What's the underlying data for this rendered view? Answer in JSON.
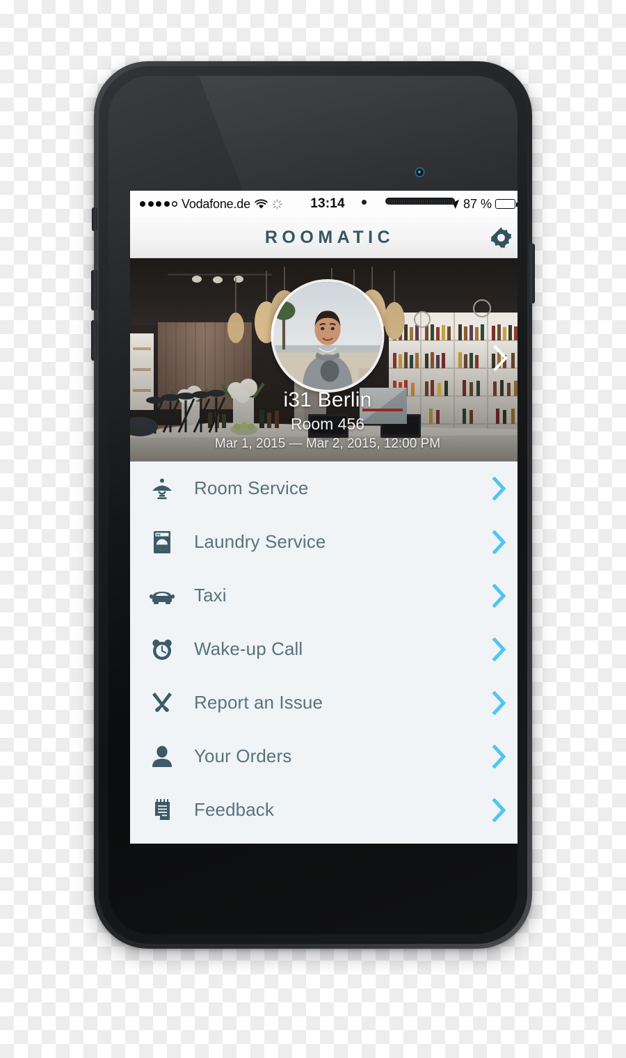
{
  "status_bar": {
    "signal_dots_filled": 4,
    "signal_dots_total": 5,
    "carrier": "Vodafone.de",
    "wifi_icon": "wifi-icon",
    "activity_icon": "activity-spinner-icon",
    "time": "13:14",
    "location_icon": "location-arrow-icon",
    "battery_percent": "87 %",
    "battery_level": 87,
    "battery_icon": "battery-icon"
  },
  "nav_bar": {
    "title": "ROOMATIC",
    "settings_icon": "gear-icon",
    "title_color": "#36565f"
  },
  "hero": {
    "avatar_icon": "user-avatar",
    "hotel_name": "i31 Berlin",
    "room": "Room 456",
    "dates": "Mar 1, 2015 — Mar 2, 2015, 12:00 PM",
    "chevron_icon": "chevron-right-icon"
  },
  "menu": {
    "chevron_icon": "chevron-right-icon",
    "chevron_color": "#4fc6f0",
    "icon_color": "#3d5a66",
    "label_color": "#5c717c",
    "background": "#f0f4f7",
    "items": [
      {
        "label": "Room Service",
        "icon": "room-service-cloche-icon"
      },
      {
        "label": "Laundry Service",
        "icon": "washing-machine-icon"
      },
      {
        "label": "Taxi",
        "icon": "car-icon"
      },
      {
        "label": "Wake-up Call",
        "icon": "alarm-clock-icon"
      },
      {
        "label": "Report an Issue",
        "icon": "tools-icon"
      },
      {
        "label": "Your Orders",
        "icon": "person-icon"
      },
      {
        "label": "Feedback",
        "icon": "notepad-icon"
      }
    ]
  },
  "device": {
    "home_button": "home-button",
    "camera": "front-camera",
    "speaker": "earpiece-speaker",
    "mute_switch": "mute-switch",
    "volume_up": "volume-up-button",
    "volume_down": "volume-down-button",
    "power_button": "power-button"
  }
}
